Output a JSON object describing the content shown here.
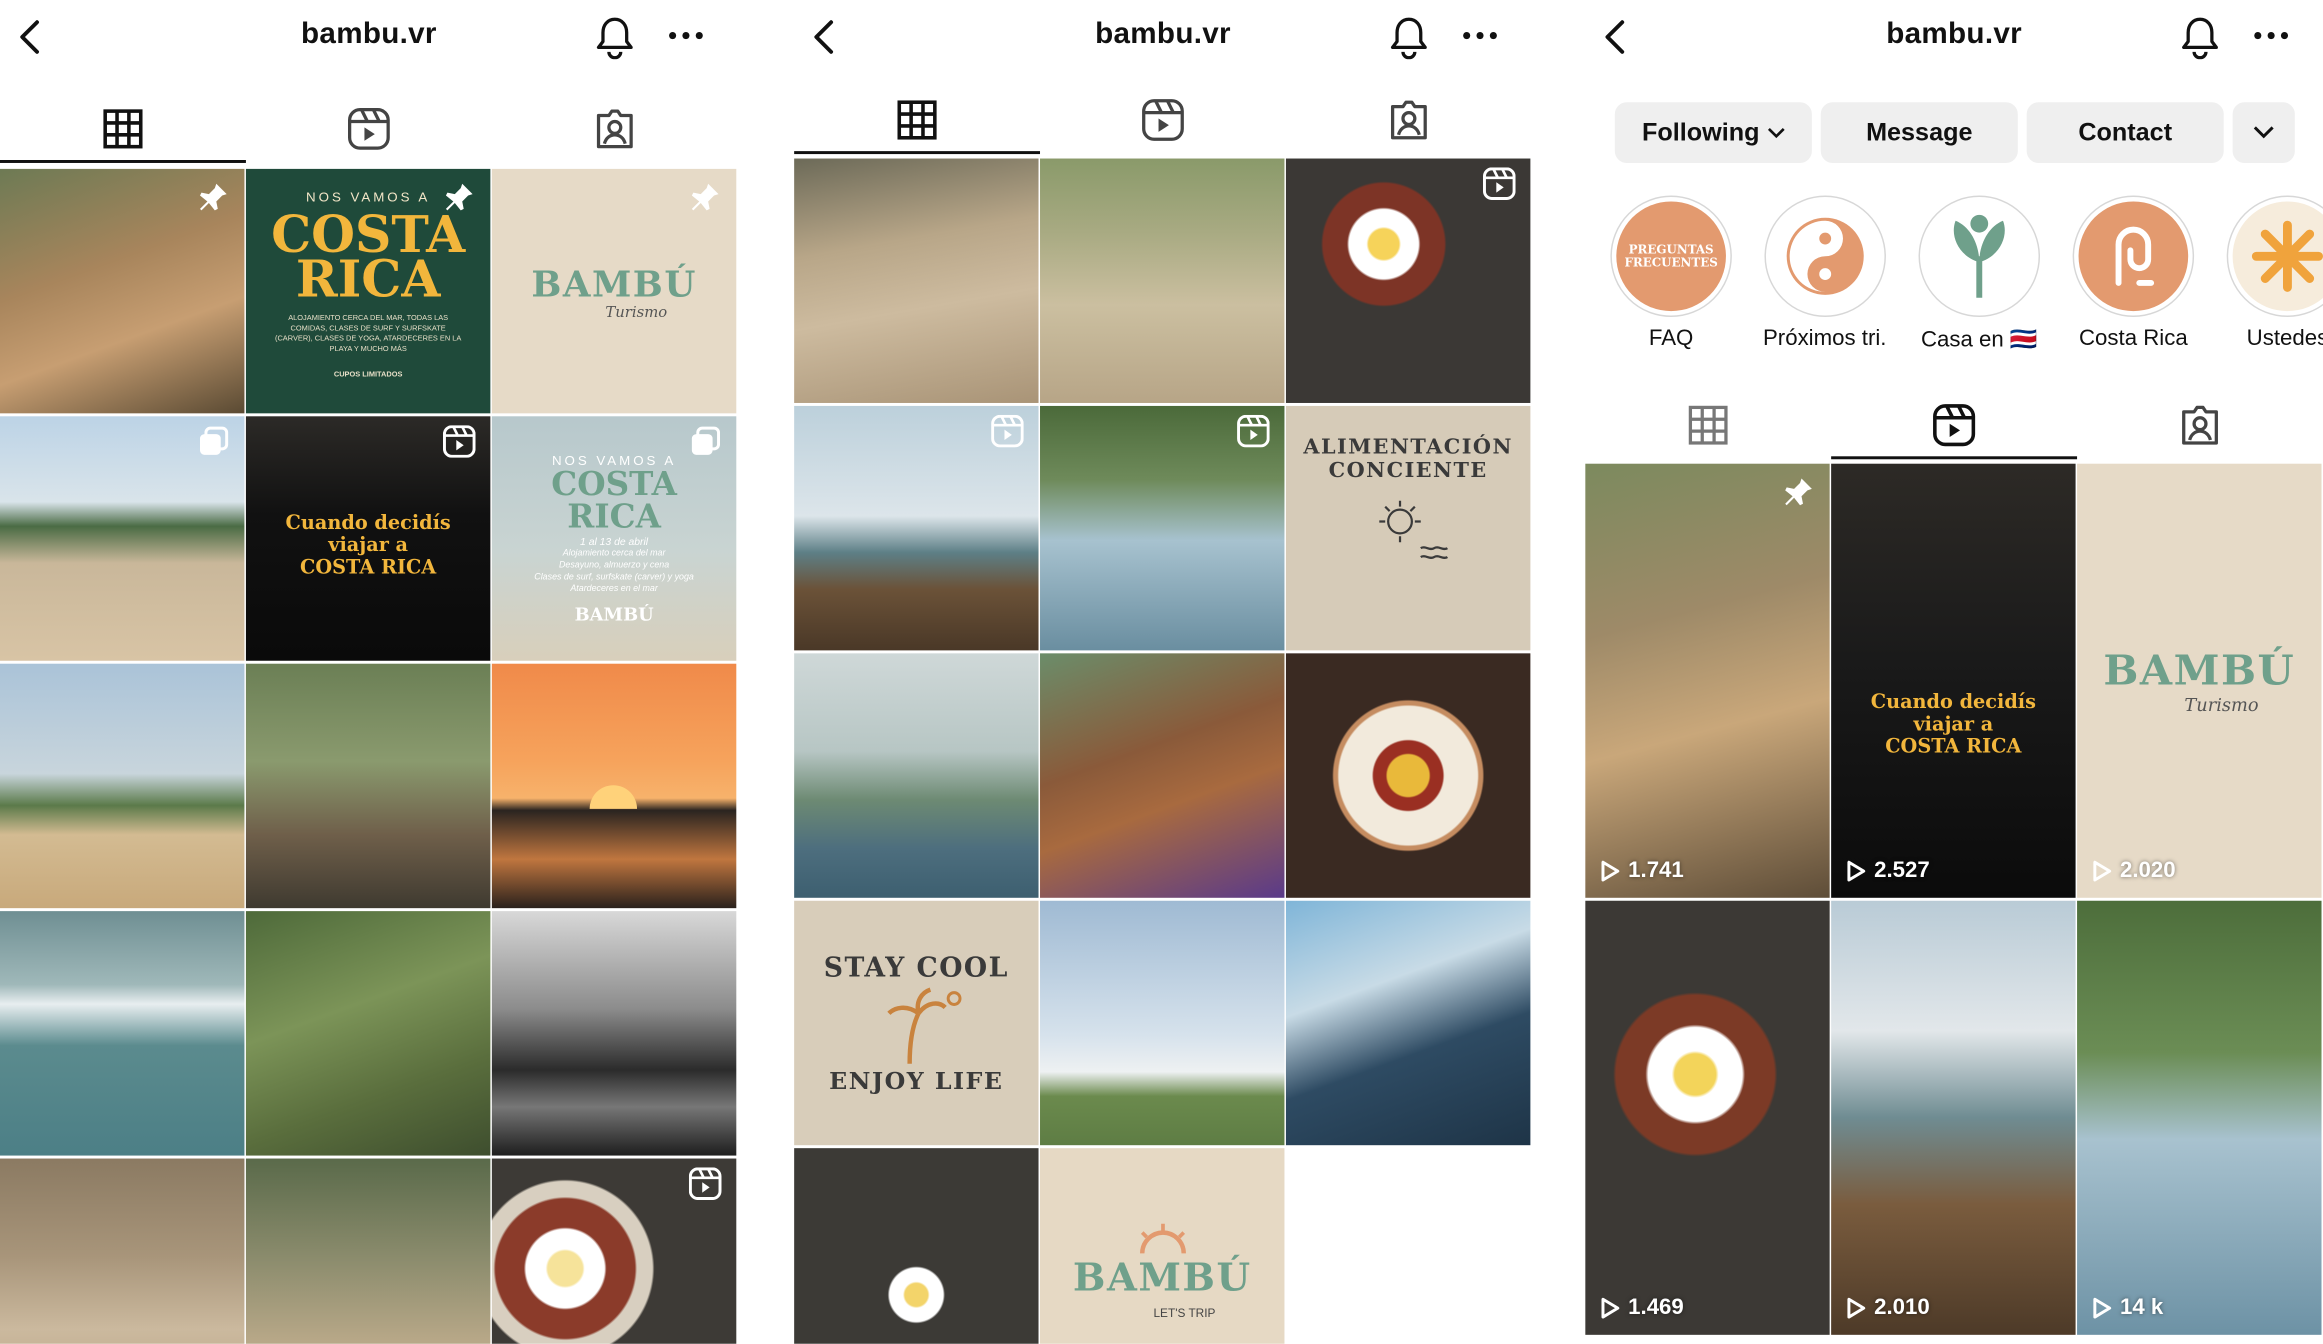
{
  "username": "bambu.vr",
  "colors": {
    "accent": "#e39a6f",
    "green": "#6fa08b",
    "beige": "#e8dccb"
  },
  "icons": {
    "back": "chevron-left-icon",
    "bell": "bell-icon",
    "more": "more-icon",
    "grid": "grid-icon",
    "reels": "reels-icon",
    "tagged": "tagged-icon"
  },
  "actions": {
    "following": "Following",
    "message": "Message",
    "contact": "Contact"
  },
  "highlights": [
    {
      "label": "FAQ",
      "art": "PREGUNTAS FRECUENTES"
    },
    {
      "label": "Próximos tri..."
    },
    {
      "label": "Casa en 🇨🇷"
    },
    {
      "label": "Costa Rica"
    },
    {
      "label": "Ustedes"
    }
  ],
  "posters": {
    "costa1": {
      "top": "NOS VAMOS A",
      "big1": "COSTA",
      "big2": "RICA",
      "small": "ALOJAMIENTO CERCA DEL MAR, TODAS LAS COMIDAS, CLASES DE SURF Y SURFSKATE (CARVER), CLASES DE YOGA, ATARDECERES EN LA PLAYA Y MUCHO MÁS",
      "foot": "CUPOS LIMITADOS"
    },
    "brand": {
      "name": "BAMBÚ",
      "sub": "Turismo"
    },
    "cuando": {
      "l1": "Cuando decidís",
      "l2": "viajar a",
      "l3": "COSTA RICA"
    },
    "costa2": {
      "top": "NOS VAMOS A",
      "big1": "COSTA",
      "big2": "RICA",
      "date": "1 al 13 de abril",
      "d1": "Alojamiento cerca del mar",
      "d2": "Desayuno, almuerzo y cena",
      "d3": "Clases de surf, surfskate (carver) y yoga",
      "d4": "Atardeceres en el mar",
      "logo": "BAMBÚ"
    },
    "alimentacion": {
      "l1": "ALIMENTACIÓN",
      "l2": "CONCIENTE"
    },
    "stay": {
      "l1": "STAY COOL",
      "l2": "ENJOY LIFE"
    },
    "bambu2": {
      "name": "BAMBÚ",
      "sub": "LET'S TRIP"
    }
  },
  "reels": [
    {
      "views": "1.741"
    },
    {
      "views": "2.527"
    },
    {
      "views": "2.020"
    },
    {
      "views": "1.469"
    },
    {
      "views": "2.010"
    },
    {
      "views": "14 k"
    }
  ]
}
